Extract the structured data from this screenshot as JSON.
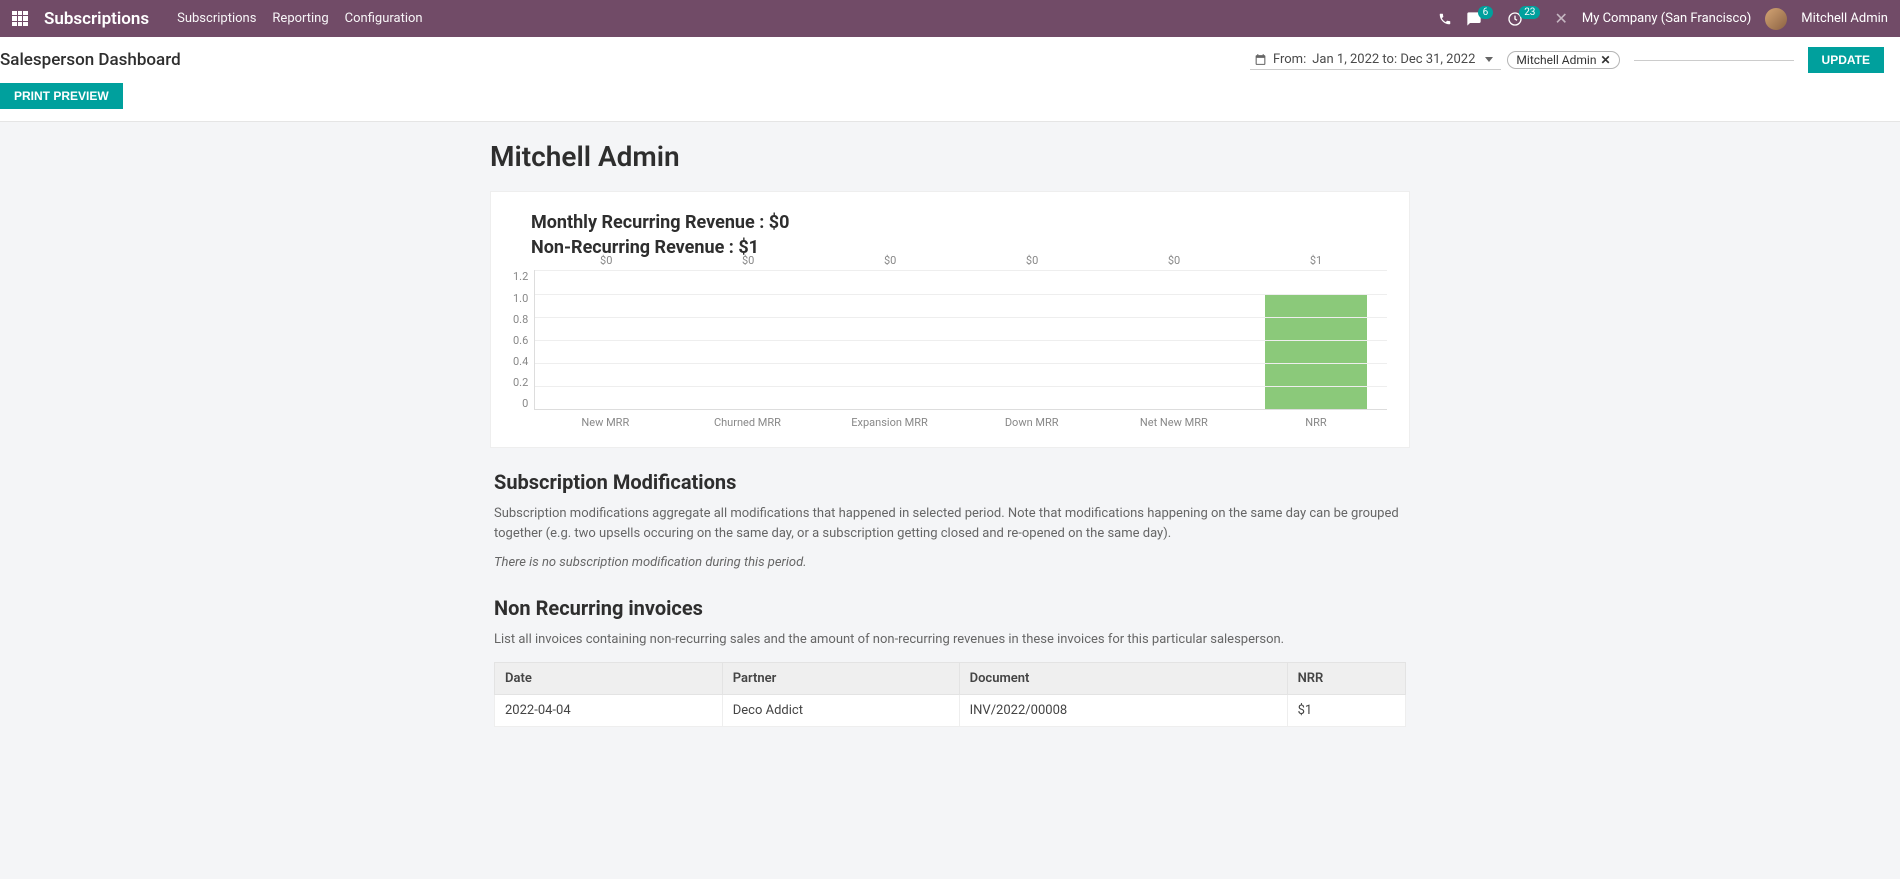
{
  "navbar": {
    "app_title": "Subscriptions",
    "links": [
      "Subscriptions",
      "Reporting",
      "Configuration"
    ],
    "msg_badge": "6",
    "clock_badge": "23",
    "company": "My Company (San Francisco)",
    "user": "Mitchell Admin"
  },
  "secondary": {
    "page_title": "Salesperson Dashboard",
    "date_prefix": "From:",
    "date_range": "Jan 1, 2022 to: Dec 31, 2022",
    "filter_tag": "Mitchell Admin",
    "update_btn": "UPDATE",
    "print_btn": "PRINT PREVIEW"
  },
  "report": {
    "salesperson": "Mitchell Admin",
    "mrr_label": "Monthly Recurring Revenue : $0",
    "nrr_label": "Non-Recurring Revenue : $1"
  },
  "chart_data": {
    "type": "bar",
    "categories": [
      "New MRR",
      "Churned MRR",
      "Expansion MRR",
      "Down MRR",
      "Net New MRR",
      "NRR"
    ],
    "values": [
      0,
      0,
      0,
      0,
      0,
      1
    ],
    "value_labels": [
      "$0",
      "$0",
      "$0",
      "$0",
      "$0",
      "$1"
    ],
    "y_ticks": [
      "1.2",
      "1.0",
      "0.8",
      "0.6",
      "0.4",
      "0.2",
      "0"
    ],
    "ylim": [
      0,
      1.2
    ],
    "title": "",
    "xlabel": "",
    "ylabel": ""
  },
  "modifications": {
    "title": "Subscription Modifications",
    "desc": "Subscription modifications aggregate all modifications that happened in selected period. Note that modifications happening on the same day can be grouped together (e.g. two upsells occuring on the same day, or a subscription getting closed and re-opened on the same day).",
    "empty": "There is no subscription modification during this period."
  },
  "nrr_section": {
    "title": "Non Recurring invoices",
    "desc": "List all invoices containing non-recurring sales and the amount of non-recurring revenues in these invoices for this particular salesperson.",
    "headers": [
      "Date",
      "Partner",
      "Document",
      "NRR"
    ],
    "rows": [
      {
        "date": "2022-04-04",
        "partner": "Deco Addict",
        "document": "INV/2022/00008",
        "nrr": "$1"
      }
    ]
  }
}
